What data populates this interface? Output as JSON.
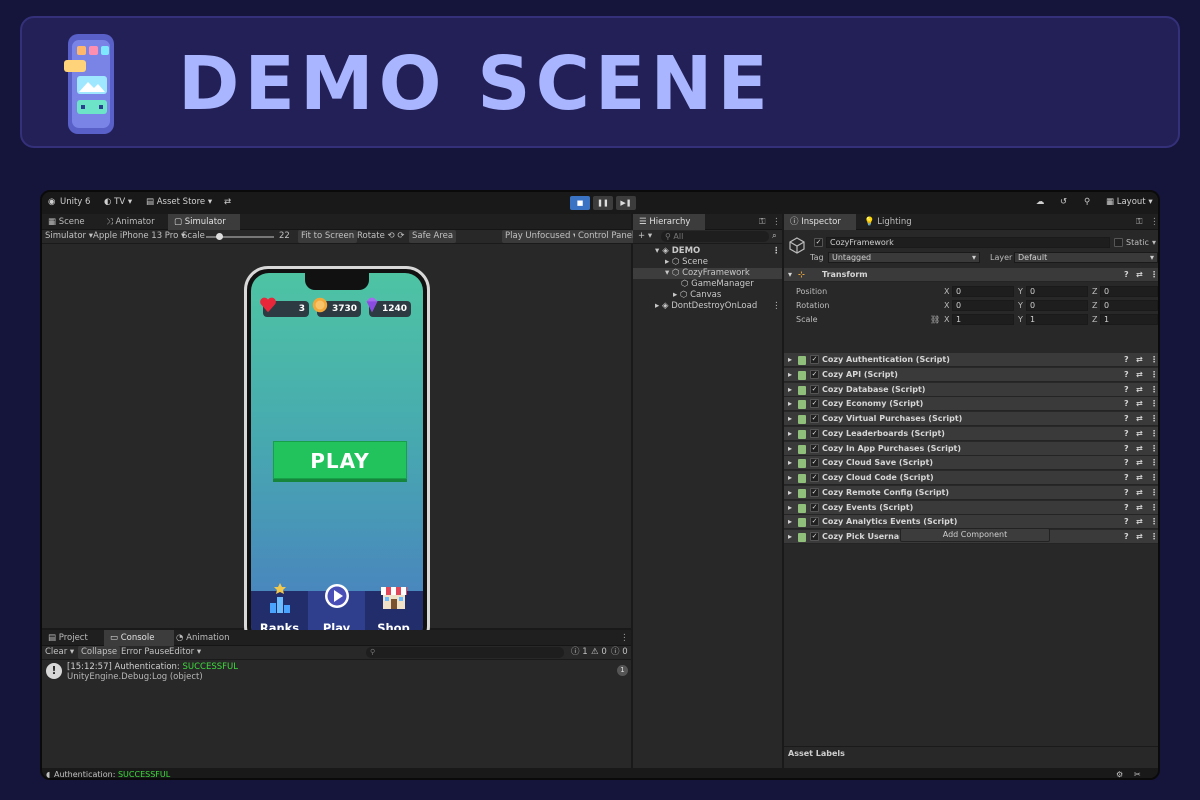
{
  "banner": {
    "title": "DEMO SCENE"
  },
  "topbar": {
    "unity": "Unity 6",
    "account": "TV",
    "asset_store": "Asset Store",
    "layout": "Layout"
  },
  "scene_tabs": [
    {
      "label": "Scene"
    },
    {
      "label": "Animator"
    },
    {
      "label": "Simulator"
    }
  ],
  "simulator": {
    "mode": "Simulator",
    "device": "Apple iPhone 13 Pro",
    "scale_label": "Scale",
    "scale_value": "22",
    "fit": "Fit to Screen",
    "rotate": "Rotate",
    "safe_area": "Safe Area",
    "play_mode": "Play Unfocused",
    "control_panel": "Control Panel"
  },
  "game": {
    "hearts": "3",
    "coins": "3730",
    "gems": "1240",
    "play_button": "PLAY",
    "nav": [
      {
        "label": "Ranks"
      },
      {
        "label": "Play"
      },
      {
        "label": "Shop"
      }
    ]
  },
  "hierarchy": {
    "tab": "Hierarchy",
    "search_placeholder": "All",
    "items": [
      {
        "label": "DEMO"
      },
      {
        "label": "Scene"
      },
      {
        "label": "CozyFramework"
      },
      {
        "label": "GameManager"
      },
      {
        "label": "Canvas"
      },
      {
        "label": "DontDestroyOnLoad"
      }
    ]
  },
  "inspector": {
    "tab": "Inspector",
    "lighting_tab": "Lighting",
    "object_name": "CozyFramework",
    "static_label": "Static",
    "tag_label": "Tag",
    "tag_value": "Untagged",
    "layer_label": "Layer",
    "layer_value": "Default",
    "transform_label": "Transform",
    "position_label": "Position",
    "rotation_label": "Rotation",
    "scale_label": "Scale",
    "axis_x": "X",
    "axis_y": "Y",
    "axis_z": "Z",
    "position": [
      "0",
      "0",
      "0"
    ],
    "rotation": [
      "0",
      "0",
      "0"
    ],
    "scale": [
      "1",
      "1",
      "1"
    ],
    "components": [
      {
        "label": "Cozy Authentication (Script)"
      },
      {
        "label": "Cozy API (Script)"
      },
      {
        "label": "Cozy Database (Script)"
      },
      {
        "label": "Cozy Economy (Script)"
      },
      {
        "label": "Cozy Virtual Purchases (Script)"
      },
      {
        "label": "Cozy Leaderboards (Script)"
      },
      {
        "label": "Cozy In App Purchases (Script)"
      },
      {
        "label": "Cozy Cloud Save (Script)"
      },
      {
        "label": "Cozy Cloud Code (Script)"
      },
      {
        "label": "Cozy Remote Config (Script)"
      },
      {
        "label": "Cozy Events (Script)"
      },
      {
        "label": "Cozy Analytics Events (Script)"
      },
      {
        "label": "Cozy Pick Username (Script)"
      }
    ],
    "add_component": "Add Component",
    "asset_labels": "Asset Labels"
  },
  "bottom_tabs": [
    {
      "label": "Project"
    },
    {
      "label": "Console"
    },
    {
      "label": "Animation"
    }
  ],
  "console": {
    "clear": "Clear",
    "collapse": "Collapse",
    "error_pause": "Error Pause",
    "editor": "Editor",
    "count_info": "1",
    "count_warn": "0",
    "count_error": "0",
    "log_time": "[15:12:57] Authentication:",
    "log_status": "SUCCESSFUL",
    "log_detail": "UnityEngine.Debug:Log (object)",
    "log_count": "1"
  },
  "statusbar": {
    "text": "Authentication:",
    "status": "SUCCESSFUL"
  },
  "colors": {
    "success": "#3ddc3d",
    "accent": "#3a72c4",
    "banner_text": "#a9b5ff"
  }
}
